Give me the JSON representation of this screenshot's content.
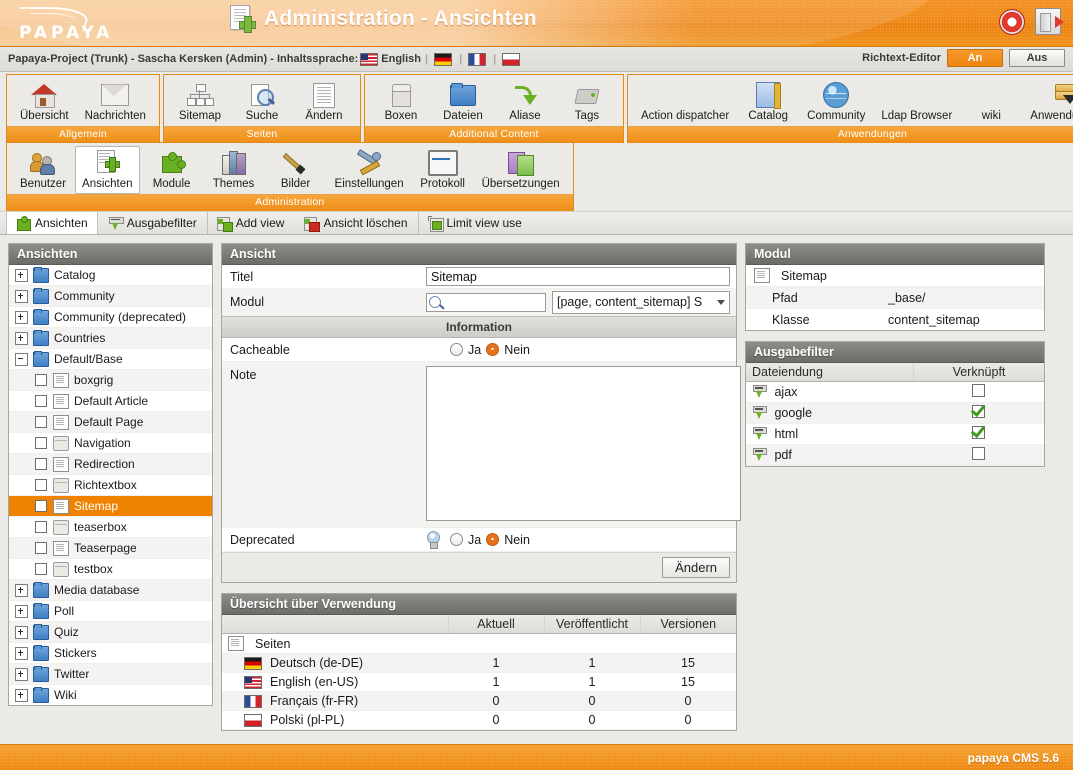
{
  "header": {
    "logo_text": "PAPAYA",
    "title": "Administration - Ansichten",
    "title_icon": "page-add-icon",
    "help_icon": "lifering-help-icon",
    "logout_icon": "logout-icon"
  },
  "subheader": {
    "breadcrumb": "Papaya-Project (Trunk) - Sascha Kersken (Admin) - Inhaltssprache:",
    "current_language": "English",
    "languages": [
      "en-US",
      "de-DE",
      "fr-FR",
      "pl-PL"
    ],
    "richtext_label": "Richtext-Editor",
    "richtext_on": "An",
    "richtext_off": "Aus"
  },
  "ribbon": {
    "groups": [
      {
        "caption": "Allgemein",
        "items": [
          {
            "label": "Übersicht",
            "icon": "home-icon",
            "active": false
          },
          {
            "label": "Nachrichten",
            "icon": "mail-icon",
            "active": false
          }
        ]
      },
      {
        "caption": "Seiten",
        "items": [
          {
            "label": "Sitemap",
            "icon": "sitemap-icon",
            "active": false
          },
          {
            "label": "Suche",
            "icon": "page-search-icon",
            "active": false
          },
          {
            "label": "Ändern",
            "icon": "document-icon",
            "active": false
          }
        ]
      },
      {
        "caption": "Additional Content",
        "items": [
          {
            "label": "Boxen",
            "icon": "box-icon",
            "active": false
          },
          {
            "label": "Dateien",
            "icon": "folder-icon",
            "active": false
          },
          {
            "label": "Aliase",
            "icon": "green-arrow-icon",
            "active": false
          },
          {
            "label": "Tags",
            "icon": "tag-icon",
            "active": false
          }
        ]
      },
      {
        "caption": "Anwendungen",
        "items": [
          {
            "label": "Action dispatcher",
            "icon": "none",
            "active": false
          },
          {
            "label": "Catalog",
            "icon": "book-icon",
            "active": false
          },
          {
            "label": "Community",
            "icon": "globe-icon",
            "active": false
          },
          {
            "label": "Ldap Browser",
            "icon": "none",
            "active": false
          },
          {
            "label": "wiki",
            "icon": "none",
            "active": false
          },
          {
            "label": "Anwendungen",
            "icon": "drawer-icon",
            "active": false
          }
        ]
      }
    ],
    "groups_row2": [
      {
        "caption": "Administration",
        "items": [
          {
            "label": "Benutzer",
            "icon": "users-icon",
            "active": false
          },
          {
            "label": "Ansichten",
            "icon": "page-add-icon",
            "active": true
          },
          {
            "label": "Module",
            "icon": "puzzle-icon",
            "active": false
          },
          {
            "label": "Themes",
            "icon": "themes-icon",
            "active": false
          },
          {
            "label": "Bilder",
            "icon": "brush-icon",
            "active": false
          },
          {
            "label": "Einstellungen",
            "icon": "tools-icon",
            "active": false
          },
          {
            "label": "Protokoll",
            "icon": "monitor-icon",
            "active": false
          },
          {
            "label": "Übersetzungen",
            "icon": "translations-icon",
            "active": false
          }
        ]
      }
    ]
  },
  "tabs": [
    {
      "label": "Ansichten",
      "icon": "puzzle-icon",
      "selected": true,
      "group_start": false
    },
    {
      "label": "Ausgabefilter",
      "icon": "filter-icon",
      "selected": false,
      "group_start": false
    },
    {
      "label": "Add view",
      "icon": "view-add-icon",
      "selected": false,
      "group_start": true
    },
    {
      "label": "Ansicht löschen",
      "icon": "view-delete-icon",
      "selected": false,
      "group_start": false
    },
    {
      "label": "Limit view use",
      "icon": "view-limit-icon",
      "selected": false,
      "group_start": true
    }
  ],
  "tree_panel": {
    "title": "Ansichten",
    "items": [
      {
        "label": "Catalog",
        "level": 0,
        "toggle": "plus",
        "icon": "folder-icon",
        "checkbox": false,
        "selected": false
      },
      {
        "label": "Community",
        "level": 0,
        "toggle": "plus",
        "icon": "folder-icon",
        "checkbox": false,
        "selected": false
      },
      {
        "label": "Community (deprecated)",
        "level": 0,
        "toggle": "plus",
        "icon": "folder-icon",
        "checkbox": false,
        "selected": false
      },
      {
        "label": "Countries",
        "level": 0,
        "toggle": "plus",
        "icon": "folder-icon",
        "checkbox": false,
        "selected": false
      },
      {
        "label": "Default/Base",
        "level": 0,
        "toggle": "minus",
        "icon": "folder-open-icon",
        "checkbox": false,
        "selected": false
      },
      {
        "label": "boxgrig",
        "level": 1,
        "toggle": "none",
        "icon": "page-icon",
        "checkbox": true,
        "selected": false
      },
      {
        "label": "Default Article",
        "level": 1,
        "toggle": "none",
        "icon": "page-icon",
        "checkbox": true,
        "selected": false
      },
      {
        "label": "Default Page",
        "level": 1,
        "toggle": "none",
        "icon": "page-icon",
        "checkbox": true,
        "selected": false
      },
      {
        "label": "Navigation",
        "level": 1,
        "toggle": "none",
        "icon": "box-icon",
        "checkbox": true,
        "selected": false
      },
      {
        "label": "Redirection",
        "level": 1,
        "toggle": "none",
        "icon": "page-icon",
        "checkbox": true,
        "selected": false
      },
      {
        "label": "Richtextbox",
        "level": 1,
        "toggle": "none",
        "icon": "box-icon",
        "checkbox": true,
        "selected": false
      },
      {
        "label": "Sitemap",
        "level": 1,
        "toggle": "none",
        "icon": "page-icon",
        "checkbox": true,
        "selected": true
      },
      {
        "label": "teaserbox",
        "level": 1,
        "toggle": "none",
        "icon": "box-icon",
        "checkbox": true,
        "selected": false
      },
      {
        "label": "Teaserpage",
        "level": 1,
        "toggle": "none",
        "icon": "page-icon",
        "checkbox": true,
        "selected": false
      },
      {
        "label": "testbox",
        "level": 1,
        "toggle": "none",
        "icon": "box-icon",
        "checkbox": true,
        "selected": false
      },
      {
        "label": "Media database",
        "level": 0,
        "toggle": "plus",
        "icon": "folder-icon",
        "checkbox": false,
        "selected": false
      },
      {
        "label": "Poll",
        "level": 0,
        "toggle": "plus",
        "icon": "folder-icon",
        "checkbox": false,
        "selected": false
      },
      {
        "label": "Quiz",
        "level": 0,
        "toggle": "plus",
        "icon": "folder-icon",
        "checkbox": false,
        "selected": false
      },
      {
        "label": "Stickers",
        "level": 0,
        "toggle": "plus",
        "icon": "folder-icon",
        "checkbox": false,
        "selected": false
      },
      {
        "label": "Twitter",
        "level": 0,
        "toggle": "plus",
        "icon": "folder-icon",
        "checkbox": false,
        "selected": false
      },
      {
        "label": "Wiki",
        "level": 0,
        "toggle": "plus",
        "icon": "folder-icon",
        "checkbox": false,
        "selected": false
      }
    ]
  },
  "view_form": {
    "title": "Ansicht",
    "titel_label": "Titel",
    "titel_value": "Sitemap",
    "modul_label": "Modul",
    "modul_search_value": "",
    "modul_select_value": "[page, content_sitemap] S",
    "information_header": "Information",
    "cacheable_label": "Cacheable",
    "cacheable_yes": "Ja",
    "cacheable_no": "Nein",
    "cacheable_selected": "Nein",
    "note_label": "Note",
    "note_value": "",
    "deprecated_label": "Deprecated",
    "deprecated_yes": "Ja",
    "deprecated_no": "Nein",
    "deprecated_selected": "Nein",
    "submit_label": "Ändern"
  },
  "usage": {
    "title": "Übersicht über Verwendung",
    "columns": [
      "",
      "Aktuell",
      "Veröffentlicht",
      "Versionen"
    ],
    "group_label": "Seiten",
    "rows": [
      {
        "language": "Deutsch (de-DE)",
        "flag": "de",
        "aktuell": "1",
        "veroeffentlicht": "1",
        "versionen": "15"
      },
      {
        "language": "English (en-US)",
        "flag": "us",
        "aktuell": "1",
        "veroeffentlicht": "1",
        "versionen": "15"
      },
      {
        "language": "Français (fr-FR)",
        "flag": "fr",
        "aktuell": "0",
        "veroeffentlicht": "0",
        "versionen": "0"
      },
      {
        "language": "Polski (pl-PL)",
        "flag": "pl",
        "aktuell": "0",
        "veroeffentlicht": "0",
        "versionen": "0"
      }
    ]
  },
  "modul_panel": {
    "title": "Modul",
    "name": "Sitemap",
    "pfad_label": "Pfad",
    "pfad_value": "_base/",
    "klasse_label": "Klasse",
    "klasse_value": "content_sitemap"
  },
  "filter_panel": {
    "title": "Ausgabefilter",
    "col_name": "Dateiendung",
    "col_linked": "Verknüpft",
    "rows": [
      {
        "name": "ajax",
        "linked": false
      },
      {
        "name": "google",
        "linked": true
      },
      {
        "name": "html",
        "linked": true
      },
      {
        "name": "pdf",
        "linked": false
      }
    ]
  },
  "footer": {
    "text": "papaya CMS 5.6"
  },
  "colors": {
    "brand_orange": "#ef8a14",
    "selection_orange": "#ef8200",
    "panel_header_gray": "#7c7a76",
    "page_bg": "#eceae6",
    "green_accent": "#6ab023"
  }
}
